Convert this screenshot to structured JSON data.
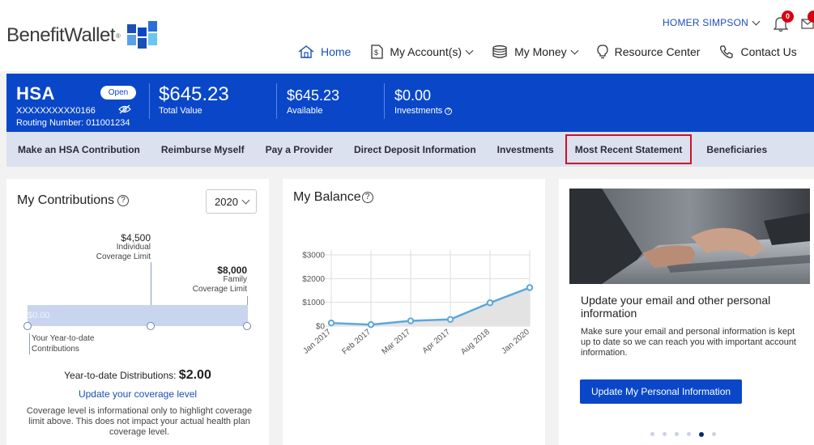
{
  "brand": {
    "name": "BenefitWallet",
    "reg": "®"
  },
  "user": {
    "name": "HOMER SIMPSON",
    "notifications": "0"
  },
  "nav": {
    "items": [
      {
        "label": "Home",
        "icon": "home-icon"
      },
      {
        "label": "My Account(s)",
        "icon": "dollar-document-icon"
      },
      {
        "label": "My Money",
        "icon": "coin-stack-icon"
      },
      {
        "label": "Resource Center",
        "icon": "lightbulb-icon"
      },
      {
        "label": "Contact Us",
        "icon": "phone-icon"
      }
    ]
  },
  "account": {
    "type": "HSA",
    "status": "Open",
    "number": "XXXXXXXXXX0166",
    "routing": "Routing Number: 011001234",
    "total_value": "$645.23",
    "total_label": "Total Value",
    "available": "$645.23",
    "available_label": "Available",
    "investments": "$0.00",
    "investments_label": "Investments",
    "info_glyph": "?"
  },
  "actions": [
    "Make an HSA Contribution",
    "Reimburse Myself",
    "Pay a Provider",
    "Direct Deposit Information",
    "Investments",
    "Most Recent Statement",
    "Beneficiaries"
  ],
  "contributions": {
    "title": "My Contributions",
    "help_glyph": "?",
    "year": "2020",
    "individual_limit": "$4,500",
    "individual_label_1": "Individual",
    "individual_label_2": "Coverage Limit",
    "family_limit": "$8,000",
    "family_label_1": "Family",
    "family_label_2": "Coverage Limit",
    "bar_value": "$0.00",
    "ytd_label_1": "Your Year-to-date",
    "ytd_label_2": "Contributions",
    "distributions_label": "Year-to-date Distributions:",
    "distributions_value": "$2.00",
    "update_link": "Update your coverage level",
    "note": "Coverage level is informational only to highlight coverage limit above. This does not impact your actual health plan coverage level."
  },
  "balance": {
    "title": "My Balance",
    "help_glyph": "?"
  },
  "chart_data": {
    "type": "area",
    "title": "My Balance",
    "categories": [
      "Jan 2017",
      "Feb 2017",
      "Mar 2017",
      "Apr 2017",
      "Aug 2018",
      "Jan 2020"
    ],
    "values": [
      130,
      60,
      220,
      280,
      980,
      1620
    ],
    "y_ticks": [
      "$0",
      "$1000",
      "$2000",
      "$3000"
    ],
    "ylim": [
      0,
      3000
    ],
    "grid": true,
    "colors": {
      "line": "#5aa7dd",
      "fill": "#e3e3e3",
      "grid": "#dedede"
    }
  },
  "promo": {
    "title": "Update your email and other personal information",
    "body": "Make sure your email and personal information is kept up to date so we can reach you with important account information.",
    "button": "Update My Personal Information",
    "slide_count": 6,
    "active_slide": 5
  },
  "colors": {
    "primary": "#0a47c8",
    "link": "#1a4fb5",
    "highlight": "#d0102b",
    "actionbar": "#dbe1ee"
  }
}
